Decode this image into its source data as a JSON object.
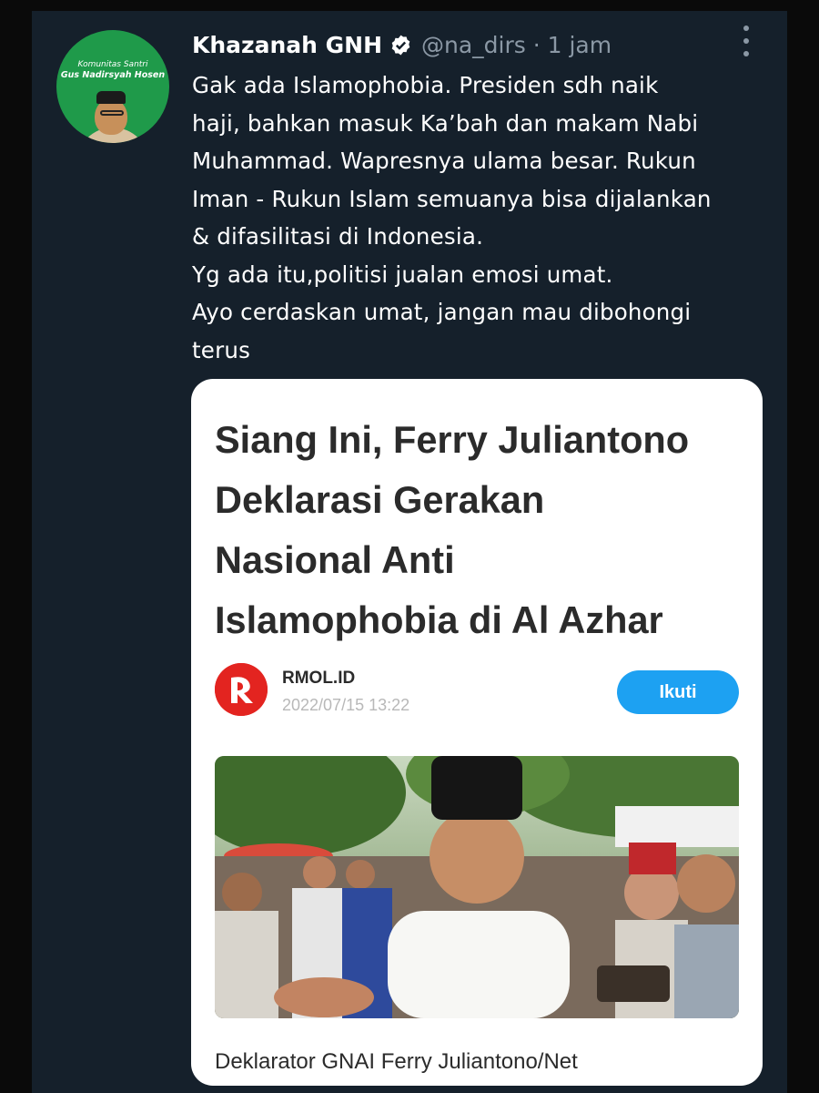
{
  "tweet": {
    "author_name": "Khazanah GNH",
    "handle": "@na_dirs · 1 jam",
    "avatar_line1": "Komunitas Santri",
    "avatar_line2": "Gus Nadirsyah Hosen",
    "text": "Gak ada Islamophobia. Presiden sdh naik\nhaji, bahkan masuk Ka’bah dan makam Nabi\nMuhammad. Wapresnya ulama besar. Rukun\nIman - Rukun Islam semuanya bisa dijalankan\n& difasilitasi di Indonesia.\nYg ada itu,politisi jualan emosi umat.\nAyo cerdaskan umat, jangan mau dibohongi\nterus"
  },
  "card": {
    "headline": "Siang Ini, Ferry Juliantono\nDeklarasi Gerakan\nNasional Anti\nIslamophobia di Al Azhar",
    "publisher": "RMOL.ID",
    "date": "2022/07/15 13:22",
    "follow_label": "Ikuti",
    "caption": "Deklarator GNAI Ferry Juliantono/Net"
  },
  "colors": {
    "background": "#15202b",
    "verified": "#1d9bf0",
    "follow_button": "#1da1f2",
    "logo": "#e32420"
  },
  "icons": [
    "verified-badge-icon",
    "more-options-icon",
    "rmol-logo-icon"
  ]
}
